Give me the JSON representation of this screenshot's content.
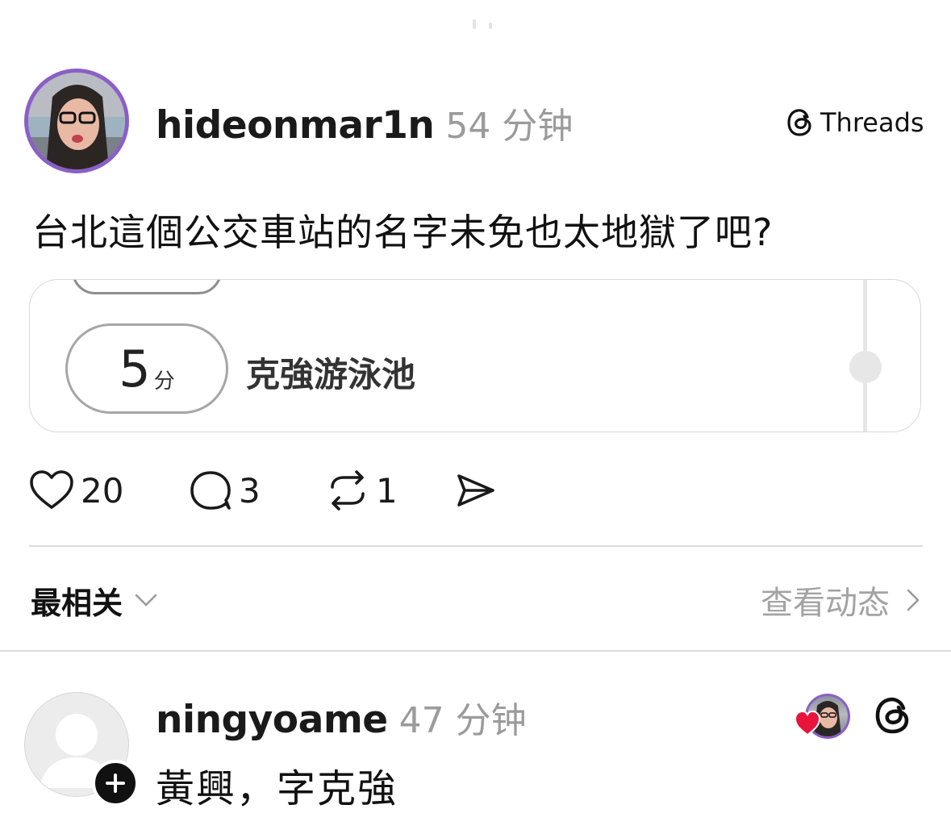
{
  "post": {
    "author": "hideonmar1n",
    "time": "54 分钟",
    "source_label": "Threads",
    "text": "台北這個公交車站的名字未免也太地獄了吧?",
    "card": {
      "minutes": "5",
      "minutes_unit": "分",
      "station_name": "克強游泳池"
    },
    "stats": {
      "likes": "20",
      "comments": "3",
      "reposts": "1"
    }
  },
  "replies_header": {
    "sort_label": "最相关",
    "activity_label": "查看动态"
  },
  "reply": {
    "author": "ningyoame",
    "time": "47 分钟",
    "text": "黃興，字克強"
  },
  "colors": {
    "avatar_ring": "#8a5fc7",
    "muted_text": "#9b9b9b",
    "like_heart": "#e8143c"
  }
}
